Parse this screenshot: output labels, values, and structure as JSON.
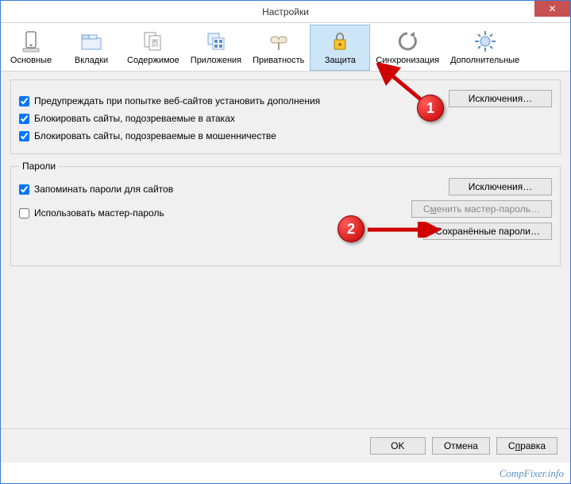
{
  "window": {
    "title": "Настройки",
    "close": "✕"
  },
  "toolbar": {
    "items": [
      {
        "label": "Основные",
        "icon": "general"
      },
      {
        "label": "Вкладки",
        "icon": "tabs"
      },
      {
        "label": "Содержимое",
        "icon": "content"
      },
      {
        "label": "Приложения",
        "icon": "apps"
      },
      {
        "label": "Приватность",
        "icon": "privacy"
      },
      {
        "label": "Защита",
        "icon": "security",
        "active": true
      },
      {
        "label": "Синхронизация",
        "icon": "sync"
      },
      {
        "label": "Дополнительные",
        "icon": "advanced"
      }
    ]
  },
  "section1": {
    "check1": "Предупреждать при попытке веб-сайтов установить дополнения",
    "check2": "Блокировать сайты, подозреваемые в атаках",
    "check3": "Блокировать сайты, подозреваемые в мошенничестве",
    "exclusions": "Исключения…"
  },
  "section2": {
    "legend": "Пароли",
    "check1": "Запоминать пароли для сайтов",
    "check2": "Использовать мастер-пароль",
    "exclusions": "Исключения…",
    "change_master_pre": "С",
    "change_master_u": "м",
    "change_master_post": "енить мастер-пароль…",
    "saved_passwords": "Сохранённые пароли…"
  },
  "footer": {
    "ok": "OK",
    "cancel": "Отмена",
    "help_pre": "С",
    "help_u": "п",
    "help_post": "равка"
  },
  "annotations": {
    "b1": "1",
    "b2": "2"
  },
  "watermark": "CompFixer.info"
}
